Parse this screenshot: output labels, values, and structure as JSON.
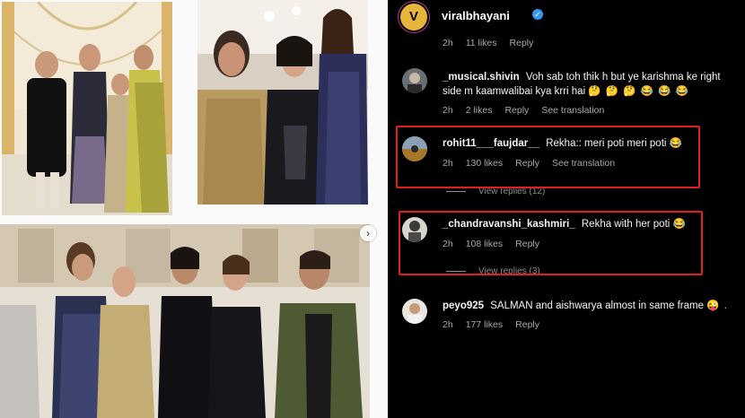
{
  "post_header": {
    "username": "viralbhayani",
    "avatar_letter": "V",
    "verified_mark": "✓"
  },
  "photos": {
    "next_arrow": "›"
  },
  "top_meta": {
    "time": "2h",
    "likes": "11 likes",
    "reply": "Reply"
  },
  "comments": [
    {
      "username": "_musical.shivin",
      "text": "Voh sab toh thik h but ye karishma ke right side m kaamwalibai kya krri hai",
      "emojis": "🤔 🤔 🤔 😂 😂 😂",
      "time": "2h",
      "likes": "2 likes",
      "reply": "Reply",
      "translation": "See translation",
      "view_replies": ""
    },
    {
      "username": "rohit11___faujdar__",
      "text": "Rekha:: meri poti meri poti",
      "emojis": "😂",
      "time": "2h",
      "likes": "130 likes",
      "reply": "Reply",
      "translation": "See translation",
      "view_replies": "View replies (12)"
    },
    {
      "username": "_chandravanshi_kashmiri_",
      "text": "Rekha with her poti",
      "emojis": "😂",
      "time": "2h",
      "likes": "108 likes",
      "reply": "Reply",
      "translation": "",
      "view_replies": "View replies (3)"
    },
    {
      "username": "peyo925",
      "text": "SALMAN and aishwarya almost in same frame",
      "emojis": "😜 .",
      "time": "2h",
      "likes": "177 likes",
      "reply": "Reply",
      "translation": "",
      "view_replies": ""
    }
  ],
  "colors": {
    "highlight": "#e0201c",
    "panel": "#000000",
    "muted": "#a8a8a8",
    "verified": "#3897f0"
  }
}
